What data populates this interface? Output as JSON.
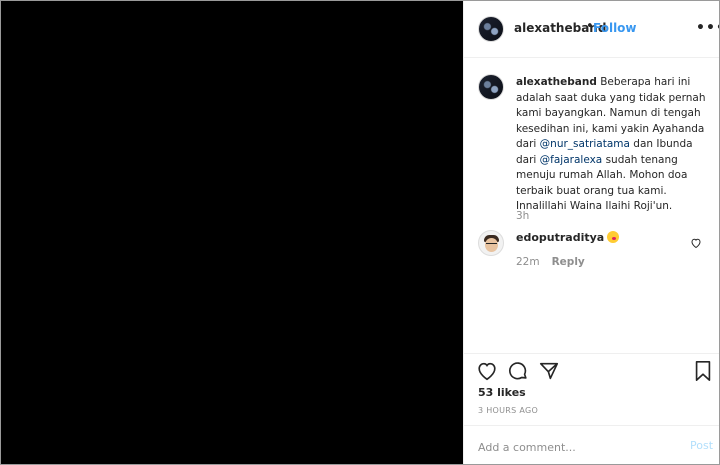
{
  "header": {
    "username": "alexatheband",
    "dot": "•",
    "follow_label": "Follow",
    "more_label": "•••"
  },
  "caption": {
    "username": "alexatheband",
    "text_1": " Beberapa hari ini adalah saat duka yang tidak pernah kami bayangkan. Namun di tengah kesedihan ini, kami yakin Ayahanda dari ",
    "mention_1": "@nur_satriatama",
    "text_2": " dan Ibunda dari ",
    "mention_2": "@fajaralexa",
    "text_3": " sudah tenang menuju rumah Allah. Mohon doa terbaik buat orang tua kami. Innalillahi Waina Ilaihi Roji'un.",
    "time": "3h"
  },
  "comment": {
    "username": "edoputraditya",
    "emoji_icon": "kissing-face-emoji",
    "time": "22m",
    "reply_label": "Reply"
  },
  "actions": {
    "likes": "53 likes",
    "posted": "3 HOURS AGO"
  },
  "add_comment": {
    "placeholder": "Add a comment...",
    "post_label": "Post"
  },
  "colors": {
    "link": "#3897f0",
    "mention": "#003569",
    "muted": "#8e8e8e",
    "post_disabled": "#b2dffc"
  }
}
